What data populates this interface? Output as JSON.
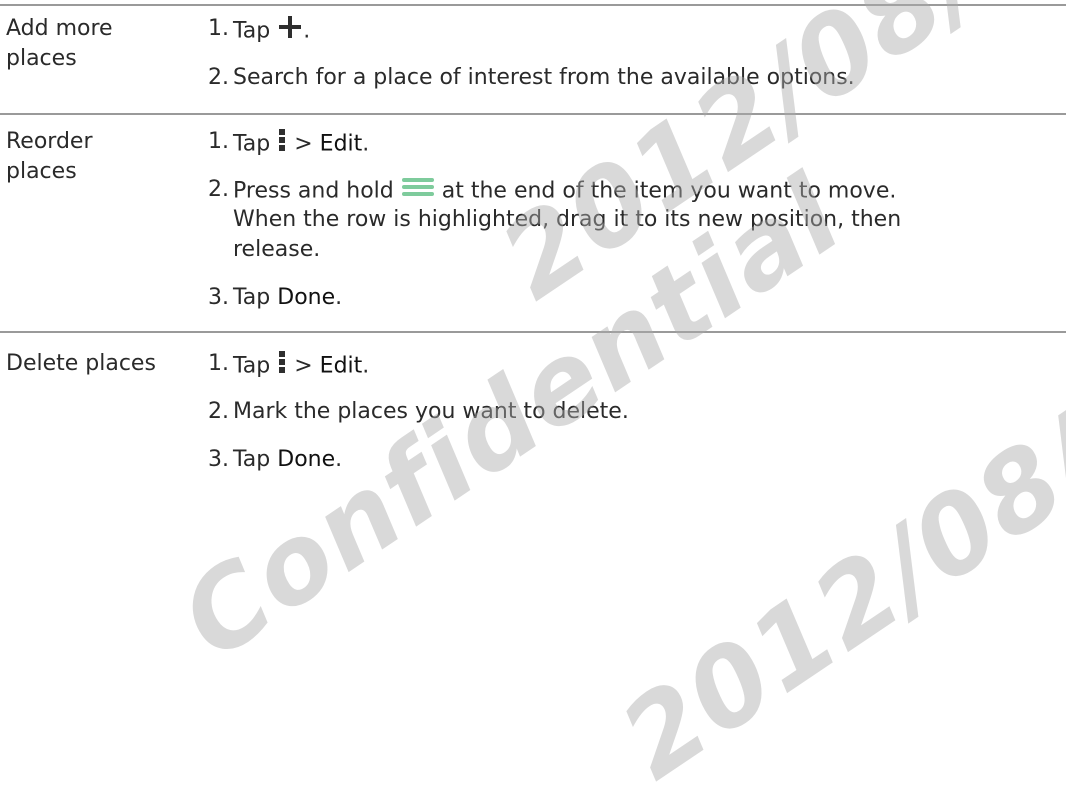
{
  "rows": [
    {
      "task": "Add more\nplaces",
      "steps": [
        {
          "n": "1.",
          "a": "Tap ",
          "icon": "plus-icon",
          "b": "."
        },
        {
          "n": "2.",
          "a": "Search for a place of interest from the available options."
        }
      ]
    },
    {
      "task": "Reorder\nplaces",
      "steps": [
        {
          "n": "1.",
          "a": "Tap ",
          "icon": "menu-dots-icon",
          "b": " > ",
          "c": "Edit",
          "d": "."
        },
        {
          "n": "2.",
          "a": "Press and hold ",
          "icon": "drag-handle-icon",
          "b": " at the end of the item you want to move."
        },
        {
          "n": "",
          "a": "When the row is highlighted, drag it to its new position, then"
        },
        {
          "n": "",
          "a": "release."
        },
        {
          "n": "3.",
          "a": "Tap ",
          "c": "Done",
          "d": "."
        }
      ]
    },
    {
      "task": "Delete places",
      "steps": [
        {
          "n": "1.",
          "a": "Tap ",
          "icon": "menu-dots-icon",
          "b": " > ",
          "c": "Edit",
          "d": "."
        },
        {
          "n": "2.",
          "a": "Mark the places you want to delete."
        },
        {
          "n": "3.",
          "a": "Tap ",
          "c": "Done",
          "d": "."
        }
      ]
    }
  ],
  "colors": {
    "accent_icon": "#2e2e2e",
    "handle_green": "#7ecb9c",
    "rule": "#9a9a9a"
  }
}
